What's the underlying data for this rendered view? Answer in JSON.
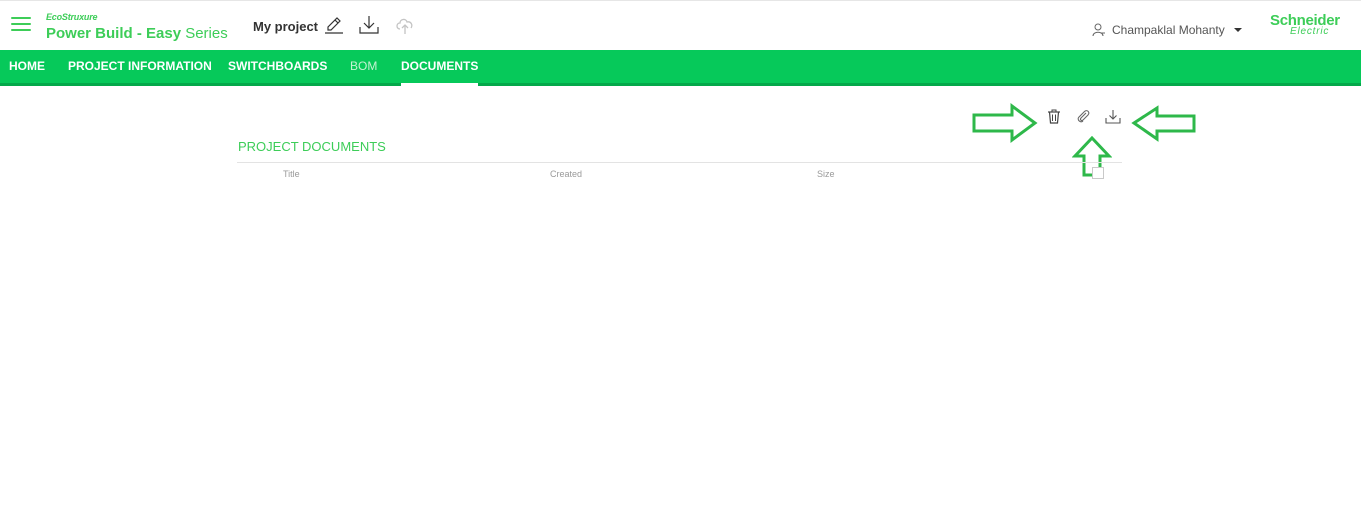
{
  "app": {
    "brand_small": "EcoStruxure",
    "brand_main": "Power Build - Easy",
    "brand_series": " Series",
    "project_name": "My project",
    "user_name": "Champaklal Mohanty",
    "logo_line1": "Schneider",
    "logo_line2": "Electric",
    "accent": "#3dcd58",
    "nav_bg": "#06c95a"
  },
  "toolbar_icons": [
    "edit-icon",
    "download-icon",
    "cloud-upload-icon"
  ],
  "nav": {
    "items": [
      {
        "label": "HOME",
        "state": "normal"
      },
      {
        "label": "PROJECT INFORMATION",
        "state": "normal"
      },
      {
        "label": "SWITCHBOARDS",
        "state": "normal"
      },
      {
        "label": "BOM",
        "state": "disabled"
      },
      {
        "label": "DOCUMENTS",
        "state": "active"
      }
    ]
  },
  "documents": {
    "title": "PROJECT DOCUMENTS",
    "columns": [
      "Title",
      "Created",
      "Size"
    ],
    "rows": [],
    "actions": [
      "trash-icon",
      "paperclip-icon",
      "download-icon"
    ]
  },
  "annotations": {
    "arrow_color": "#2eb84a",
    "arrows": [
      "arrow-right",
      "arrow-up",
      "arrow-left"
    ]
  }
}
